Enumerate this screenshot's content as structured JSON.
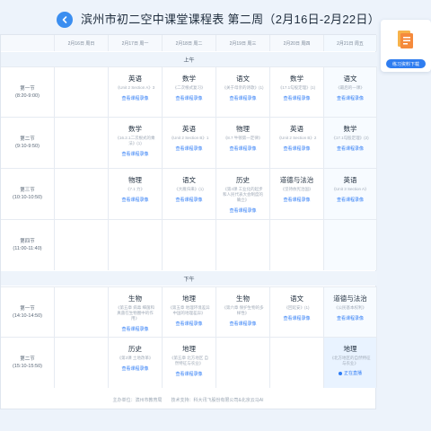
{
  "header": {
    "title": "滨州市初二空中课堂课程表 第二周（2月16日-2月22日）"
  },
  "days": [
    {
      "label": "2月16日 周日"
    },
    {
      "label": "2月17日 周一"
    },
    {
      "label": "2月18日 周二"
    },
    {
      "label": "2月19日 周三"
    },
    {
      "label": "2月20日 周四"
    },
    {
      "label": "2月21日 周五"
    }
  ],
  "sections": {
    "morning": "上午",
    "afternoon": "下午"
  },
  "rows": [
    {
      "label": "第一节",
      "time": "(8:20-9:00)"
    },
    {
      "label": "第二节",
      "time": "(9:10-9:50)"
    },
    {
      "label": "第三节",
      "time": "(10:10-10:50)"
    },
    {
      "label": "第四节",
      "time": "(11:00-11:40)"
    },
    {
      "label": "第一节",
      "time": "(14:10-14:50)"
    },
    {
      "label": "第二节",
      "time": "(15:10-15:50)"
    }
  ],
  "cell_link_text": "查看课程录像",
  "live_text": "正在直播",
  "cells": [
    [
      null,
      {
        "subject": "英语",
        "topic": "《Unit 2 Section A》3"
      },
      {
        "subject": "数学",
        "topic": "《二次根式复习》"
      },
      {
        "subject": "语文",
        "topic": "《关于母亲的诗歌》(1)"
      },
      {
        "subject": "数学",
        "topic": "《17.1勾股定理》(1)"
      },
      {
        "subject": "语文",
        "topic": "《最后的一课》"
      }
    ],
    [
      null,
      {
        "subject": "数学",
        "topic": "《16.2.1二次根式的乘法》(1)"
      },
      {
        "subject": "英语",
        "topic": "《Unit 2 Section B》1"
      },
      {
        "subject": "物理",
        "topic": "《8.7 牛顿第一定律》"
      },
      {
        "subject": "英语",
        "topic": "《Unit 2 Section B》2"
      },
      {
        "subject": "数学",
        "topic": "《17.1勾股定理》(2)"
      }
    ],
    [
      null,
      {
        "subject": "物理",
        "topic": "《7.1 力》"
      },
      {
        "subject": "语文",
        "topic": "《大雁归来》(1)"
      },
      {
        "subject": "历史",
        "topic": "《第4课 工业化的起步和人民代表大会制度的确立》"
      },
      {
        "subject": "道德与法治",
        "topic": "《坚持依宪治国》"
      },
      {
        "subject": "英语",
        "topic": "《Unit 3 Section A》"
      }
    ],
    [
      null,
      null,
      null,
      null,
      null,
      null
    ],
    [
      null,
      {
        "subject": "生物",
        "topic": "《第五章 病毒 细菌和真菌在生物圈中的作用》"
      },
      {
        "subject": "地理",
        "topic": "《第五章 地理环境差异 中国的地理差异》"
      },
      {
        "subject": "生物",
        "topic": "《第六章 保护生物的多样性》"
      },
      {
        "subject": "语文",
        "topic": "《回延安》(1)"
      },
      {
        "subject": "道德与法治",
        "topic": "《公民基本权利》"
      }
    ],
    [
      null,
      {
        "subject": "历史",
        "topic": "《第3课 土地改革》"
      },
      {
        "subject": "地理",
        "topic": "《第五章 北方地区 自然特征与农业》"
      },
      null,
      null,
      {
        "subject": "地理",
        "topic": "《北方地区的自然特征与农业》",
        "live": true
      }
    ]
  ],
  "footer": {
    "text": "主办单位：滨州市教育局　　技术支持：科大讯飞股份有限公司&北京云马AI"
  },
  "sidebar": {
    "button_label": "练习资料下载",
    "icon": "document-icon"
  },
  "colors": {
    "accent": "#2e7cf6",
    "background": "#edf3fb"
  }
}
